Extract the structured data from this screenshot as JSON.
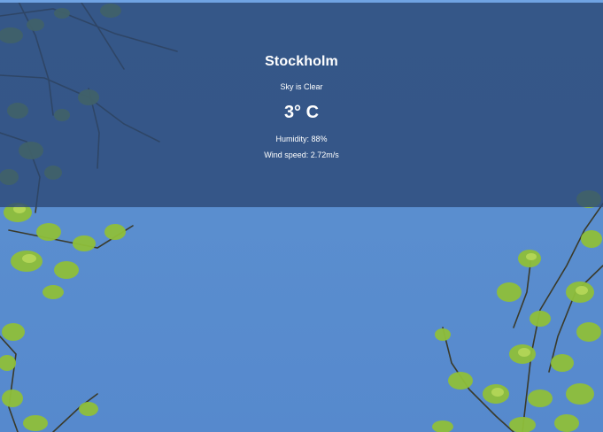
{
  "weather": {
    "city": "Stockholm",
    "condition": "Sky is Clear",
    "temperature": "3° C",
    "humidity": "Humidity: 88%",
    "wind_speed": "Wind speed: 2.72m/s"
  },
  "background": {
    "sky_color": "#5a8ecf",
    "panel_color": "#2c4876",
    "foliage_color": "#8fbf3a"
  }
}
